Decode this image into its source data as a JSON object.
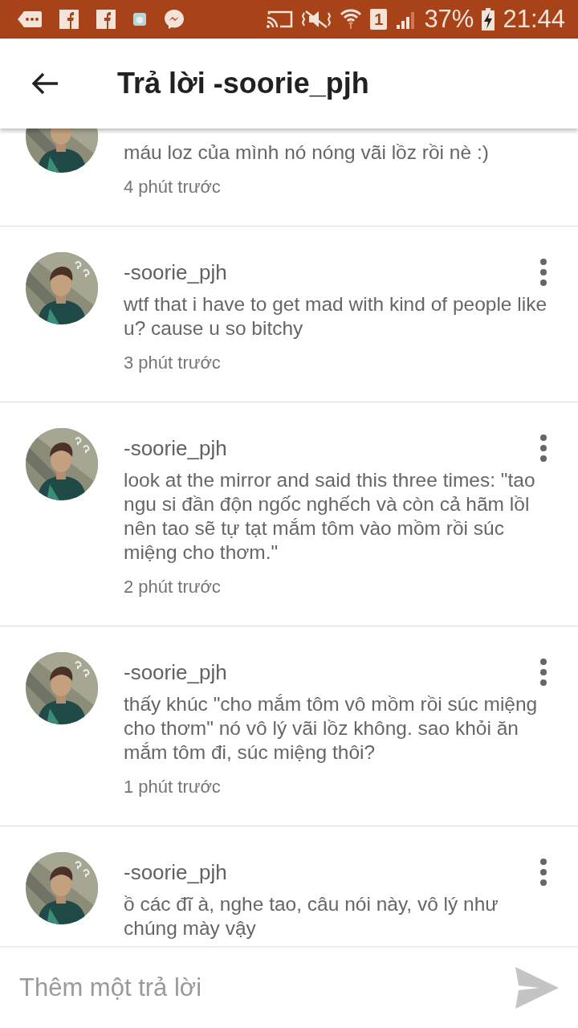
{
  "status_bar": {
    "sim": "1",
    "battery": "37%",
    "time": "21:44"
  },
  "app_bar": {
    "title": "Trả lời -soorie_pjh"
  },
  "comments": [
    {
      "text": "máu loz của mình nó nóng vãi lồz rồi nè :)",
      "time": "4 phút trước"
    },
    {
      "author": "-soorie_pjh",
      "text": "wtf that i have to get mad with kind of people like u? cause u so bitchy",
      "time": "3 phút trước"
    },
    {
      "author": "-soorie_pjh",
      "text": "look at the mirror and said this three times: \"tao ngu si đần độn ngốc nghếch và còn cả hãm lồl nên tao sẽ tự tạt mắm tôm vào mồm rồi súc miệng cho thơm.\"",
      "time": "2 phút trước"
    },
    {
      "author": "-soorie_pjh",
      "text": "thấy khúc \"cho mắm tôm vô mồm rồi súc miệng cho thơm\" nó vô lý vãi lồz không. sao khỏi ăn mắm tôm đi, súc miệng thôi?",
      "time": "1 phút trước"
    },
    {
      "author": "-soorie_pjh",
      "text": "ồ các đĩ à, nghe tao, câu nói này, vô lý như chúng mày vậy"
    }
  ],
  "composer": {
    "placeholder": "Thêm một trả lời"
  }
}
